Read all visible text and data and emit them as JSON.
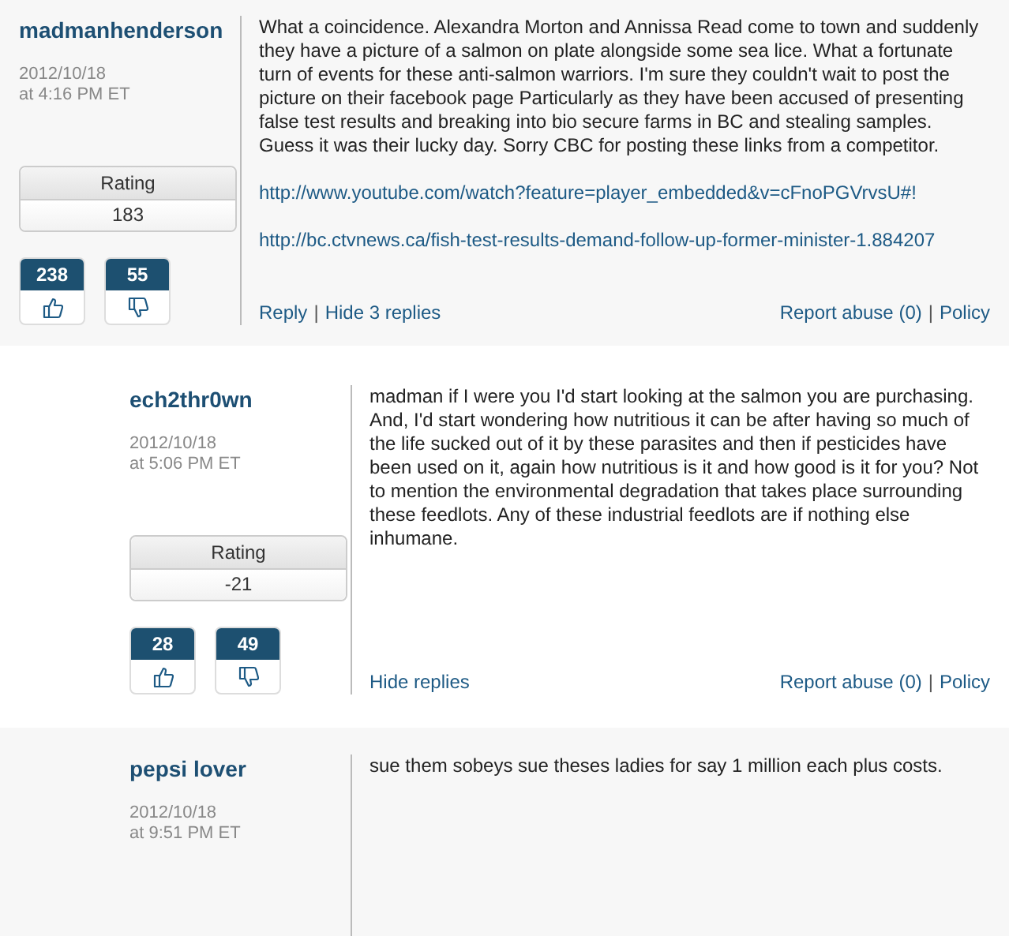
{
  "comments": [
    {
      "author": "madmanhenderson",
      "date": "2012/10/18",
      "time": "at 4:16 PM ET",
      "is_reply": false,
      "body": "What a coincidence. Alexandra Morton and Annissa Read come to town and suddenly they have a picture of a salmon on plate alongside some sea lice. What a fortunate turn of events for these anti-salmon warriors. I'm sure they couldn't wait to post the picture on their facebook page Particularly as they have been accused of presenting false test results and breaking into bio secure farms in BC and stealing samples. Guess it was their lucky day. Sorry CBC for posting these links from a competitor.",
      "links": [
        "http://www.youtube.com/watch?feature=player_embedded&v=cFnoPGVrvsU#!",
        "http://bc.ctvnews.ca/fish-test-results-demand-follow-up-former-minister-1.884207"
      ],
      "rating": {
        "label": "Rating",
        "value": "183"
      },
      "likes": "238",
      "dislikes": "55",
      "actions": [
        "Reply",
        "|",
        "Hide 3 replies"
      ],
      "report": [
        "Report abuse (0)",
        "|",
        "Policy"
      ]
    },
    {
      "author": "ech2thr0wn",
      "date": "2012/10/18",
      "time": "at 5:06 PM ET",
      "is_reply": true,
      "body": "madman if I were you I'd start looking at the salmon you are purchasing. And, I'd start wondering how nutritious it can be after having so much of the life sucked out of it by these parasites and then if pesticides have been used on it, again how nutritious is it and how good is it for you? Not to mention the environmental degradation that takes place surrounding these feedlots. Any of these industrial feedlots are if nothing else inhumane.",
      "rating": {
        "label": "Rating",
        "value": "-21"
      },
      "likes": "28",
      "dislikes": "49",
      "actions": [
        "Hide replies"
      ],
      "report": [
        "Report abuse (0)",
        "|",
        "Policy"
      ]
    },
    {
      "author": "pepsi lover",
      "date": "2012/10/18",
      "time": "at 9:51 PM ET",
      "is_reply": true,
      "body": "sue them sobeys sue theses ladies for say 1 million each plus costs."
    }
  ]
}
